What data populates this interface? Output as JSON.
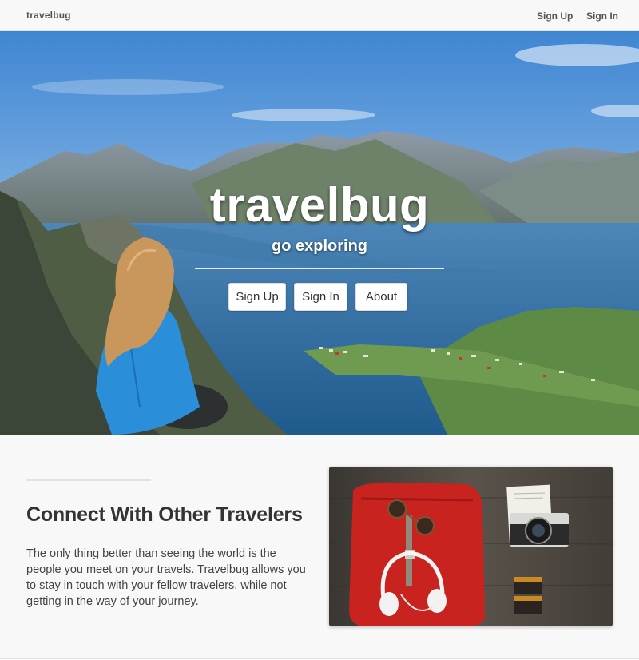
{
  "navbar": {
    "brand": "travelbug",
    "signup_label": "Sign Up",
    "signin_label": "Sign In"
  },
  "hero": {
    "title": "travelbug",
    "subtitle": "go exploring",
    "buttons": {
      "signup": "Sign Up",
      "signin": "Sign In",
      "about": "About"
    }
  },
  "feature": {
    "heading": "Connect With Other Travelers",
    "body": "The only thing better than seeing the world is the people you meet on your travels. Travelbug allows you to stay in touch with your fellow travelers, while not getting in the way of your journey."
  },
  "colors": {
    "sky": "#6fa8dc",
    "water": "#2e6ea3",
    "pack": "#c8231f"
  }
}
